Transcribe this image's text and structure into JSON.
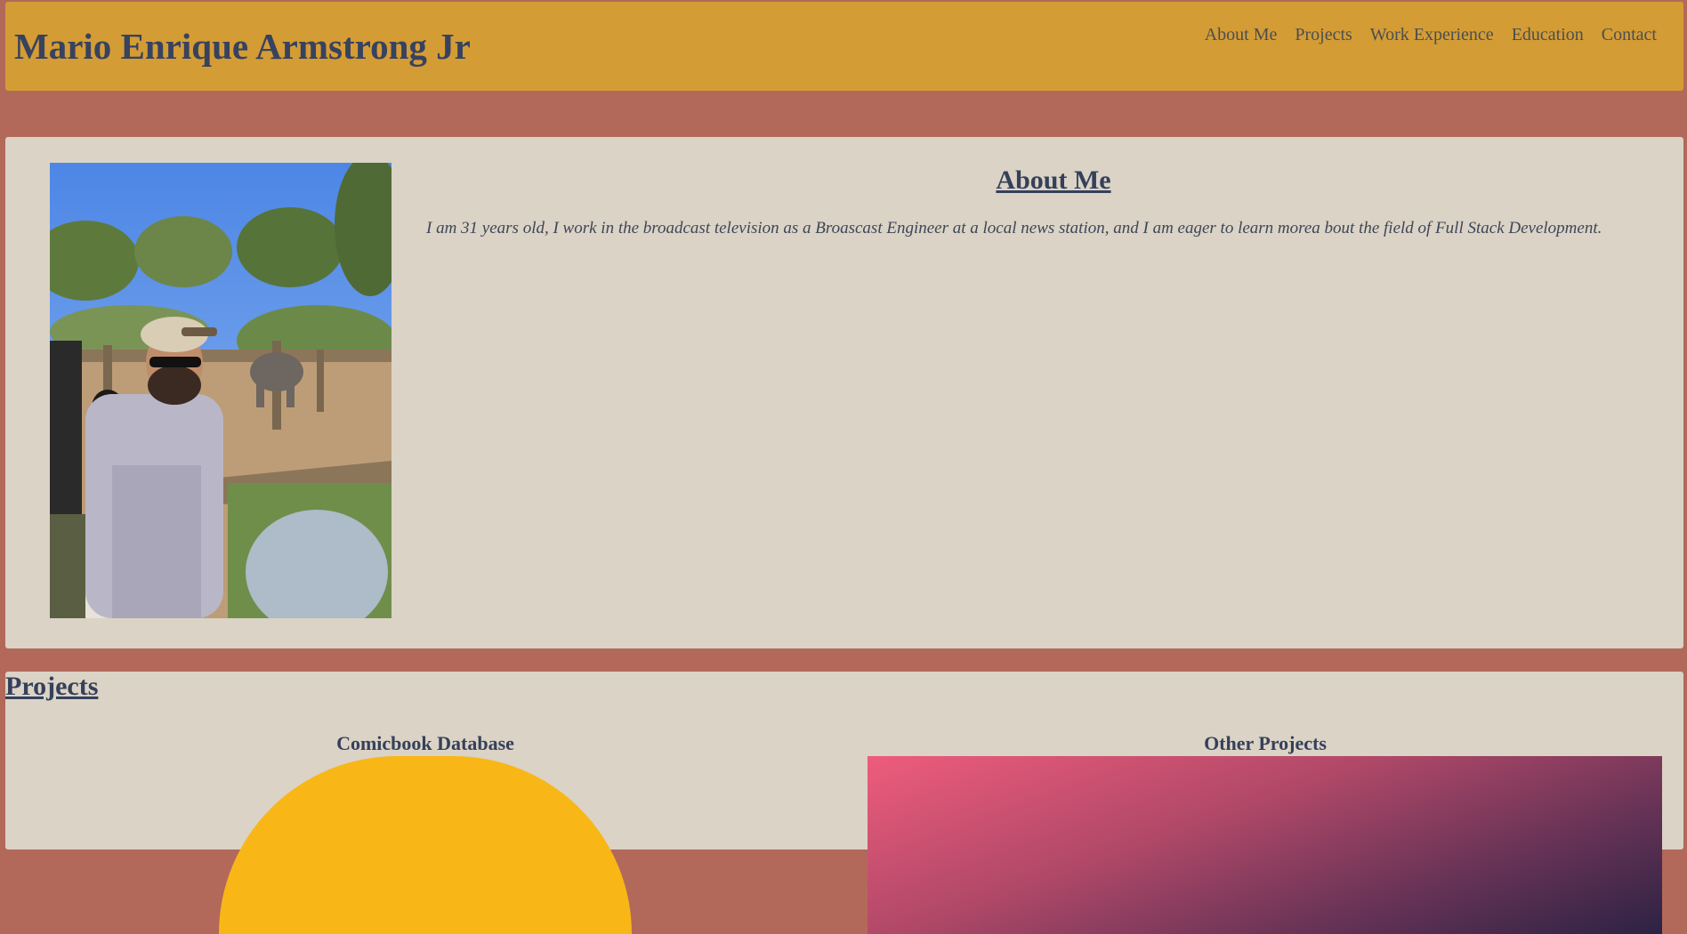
{
  "header": {
    "title": "Mario Enrique Armstrong Jr",
    "nav": [
      "About Me",
      "Projects",
      "Work Experience",
      "Education",
      "Contact"
    ]
  },
  "about": {
    "heading": "About Me",
    "text": "I am 31 years old, I work in the broadcast television as a Broascast Engineer at a local news station, and I am eager to learn morea bout the field of Full Stack Development."
  },
  "projects": {
    "heading": "Projects",
    "items": [
      {
        "title": "Comicbook Database"
      },
      {
        "title": "Other Projects"
      }
    ]
  },
  "colors": {
    "page_background": "#b2695a",
    "header_background": "#d49c34",
    "card_background": "#dbd3c6",
    "heading_text": "#35405a",
    "comicbook_thumb": "#f8b717"
  }
}
